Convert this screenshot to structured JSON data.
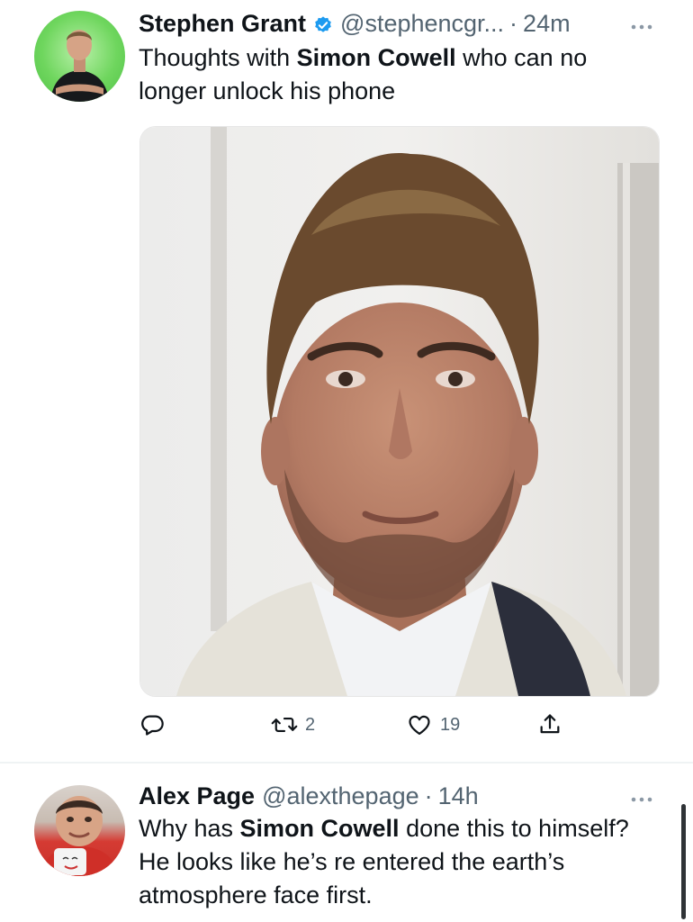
{
  "tweets": [
    {
      "author": "Stephen Grant",
      "verified": true,
      "handle": "@stephencgr...",
      "separator": "·",
      "time": "24m",
      "text_parts": [
        "Thoughts with ",
        "Simon Cowell",
        " who can no longer unlock his phone"
      ],
      "actions": {
        "reply_count": "",
        "retweet_count": "2",
        "like_count": "19"
      }
    },
    {
      "author": "Alex Page",
      "verified": false,
      "handle": "@alexthepage",
      "separator": "·",
      "time": "14h",
      "text_parts": [
        "Why has ",
        "Simon Cowell",
        " done this to himself? He looks like he’s re entered the earth’s atmosphere face first."
      ]
    }
  ],
  "colors": {
    "text_primary": "#0f1419",
    "text_secondary": "#536471",
    "verified_badge": "#1d9bf0",
    "divider": "#eff3f4"
  },
  "icons": {
    "verified": "verified-badge-icon",
    "more": "more-options-icon",
    "reply": "reply-icon",
    "retweet": "retweet-icon",
    "like": "heart-icon",
    "share": "share-icon"
  }
}
